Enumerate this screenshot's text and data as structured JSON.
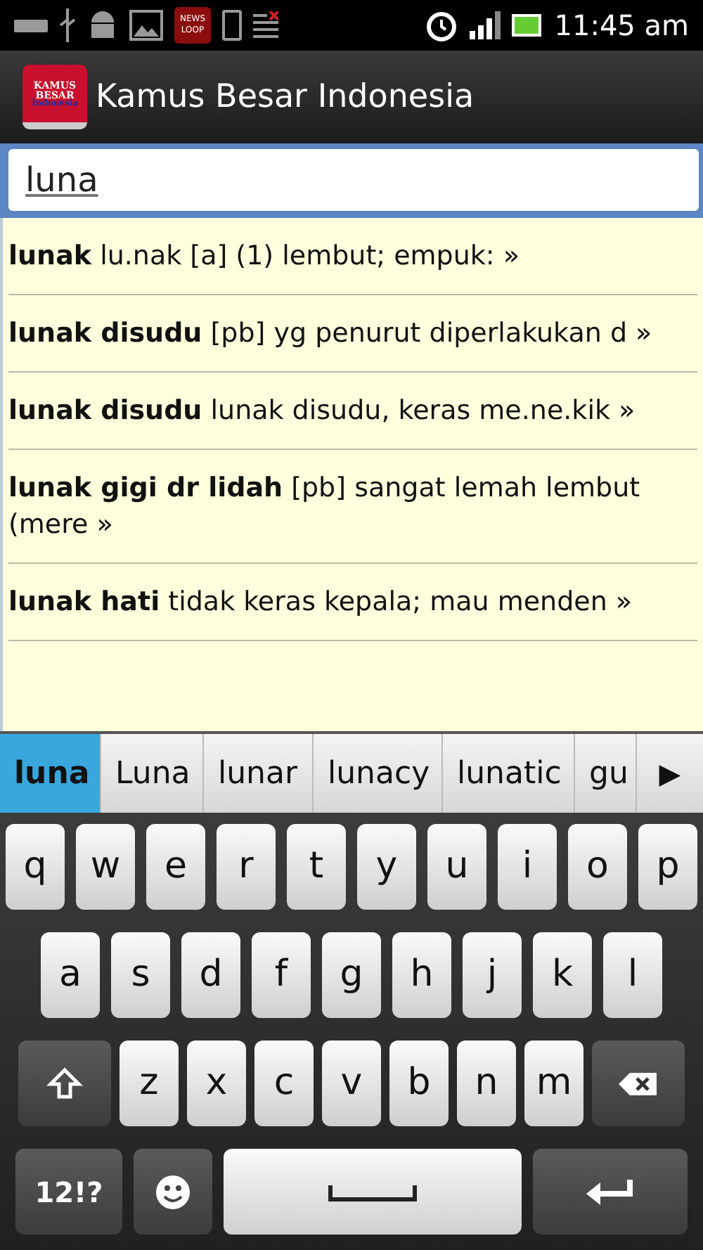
{
  "status_bar": {
    "news_icon": [
      "NEWS",
      "LOOP"
    ],
    "time": "11:45 am"
  },
  "app_bar": {
    "logo": [
      "KAMUS",
      "BESAR",
      "Indonesia"
    ],
    "title": "Kamus Besar Indonesia"
  },
  "search": {
    "value": "luna"
  },
  "results": [
    {
      "term": "lunak",
      "definition": "lu.nak [a] (1) lembut; empuk: »"
    },
    {
      "term": "lunak disudu",
      "definition": "[pb] yg penurut diperlakukan d »"
    },
    {
      "term": "lunak disudu",
      "definition": "lunak disudu, keras me.ne.kik »"
    },
    {
      "term": "lunak gigi dr lidah",
      "definition": "[pb] sangat lemah lembut (mere »"
    },
    {
      "term": "lunak hati",
      "definition": "tidak keras kepala; mau menden »"
    }
  ],
  "suggestions": [
    {
      "label": "luna",
      "selected": true
    },
    {
      "label": "Luna",
      "selected": false
    },
    {
      "label": "lunar",
      "selected": false
    },
    {
      "label": "lunacy",
      "selected": false
    },
    {
      "label": "lunatic",
      "selected": false
    },
    {
      "label": "gu",
      "selected": false
    }
  ],
  "suggestion_more": "▶",
  "keyboard": [
    [
      {
        "kind": "key",
        "label": "q"
      },
      {
        "kind": "key",
        "label": "w"
      },
      {
        "kind": "key",
        "label": "e"
      },
      {
        "kind": "key",
        "label": "r"
      },
      {
        "kind": "key",
        "label": "t"
      },
      {
        "kind": "key",
        "label": "y"
      },
      {
        "kind": "key",
        "label": "u"
      },
      {
        "kind": "key",
        "label": "i"
      },
      {
        "kind": "key",
        "label": "o"
      },
      {
        "kind": "key",
        "label": "p"
      }
    ],
    [
      {
        "kind": "key",
        "label": "a"
      },
      {
        "kind": "key",
        "label": "s"
      },
      {
        "kind": "key",
        "label": "d"
      },
      {
        "kind": "key",
        "label": "f"
      },
      {
        "kind": "key",
        "label": "g"
      },
      {
        "kind": "key",
        "label": "h"
      },
      {
        "kind": "key",
        "label": "j"
      },
      {
        "kind": "key",
        "label": "k"
      },
      {
        "kind": "key",
        "label": "l"
      }
    ],
    [
      {
        "kind": "shift"
      },
      {
        "kind": "key",
        "label": "z"
      },
      {
        "kind": "key",
        "label": "x"
      },
      {
        "kind": "key",
        "label": "c"
      },
      {
        "kind": "key",
        "label": "v"
      },
      {
        "kind": "key",
        "label": "b"
      },
      {
        "kind": "key",
        "label": "n"
      },
      {
        "kind": "key",
        "label": "m"
      },
      {
        "kind": "backspace"
      }
    ],
    [
      {
        "kind": "symbols",
        "label": "12!?"
      },
      {
        "kind": "emoji"
      },
      {
        "kind": "space"
      },
      {
        "kind": "enter"
      }
    ]
  ]
}
